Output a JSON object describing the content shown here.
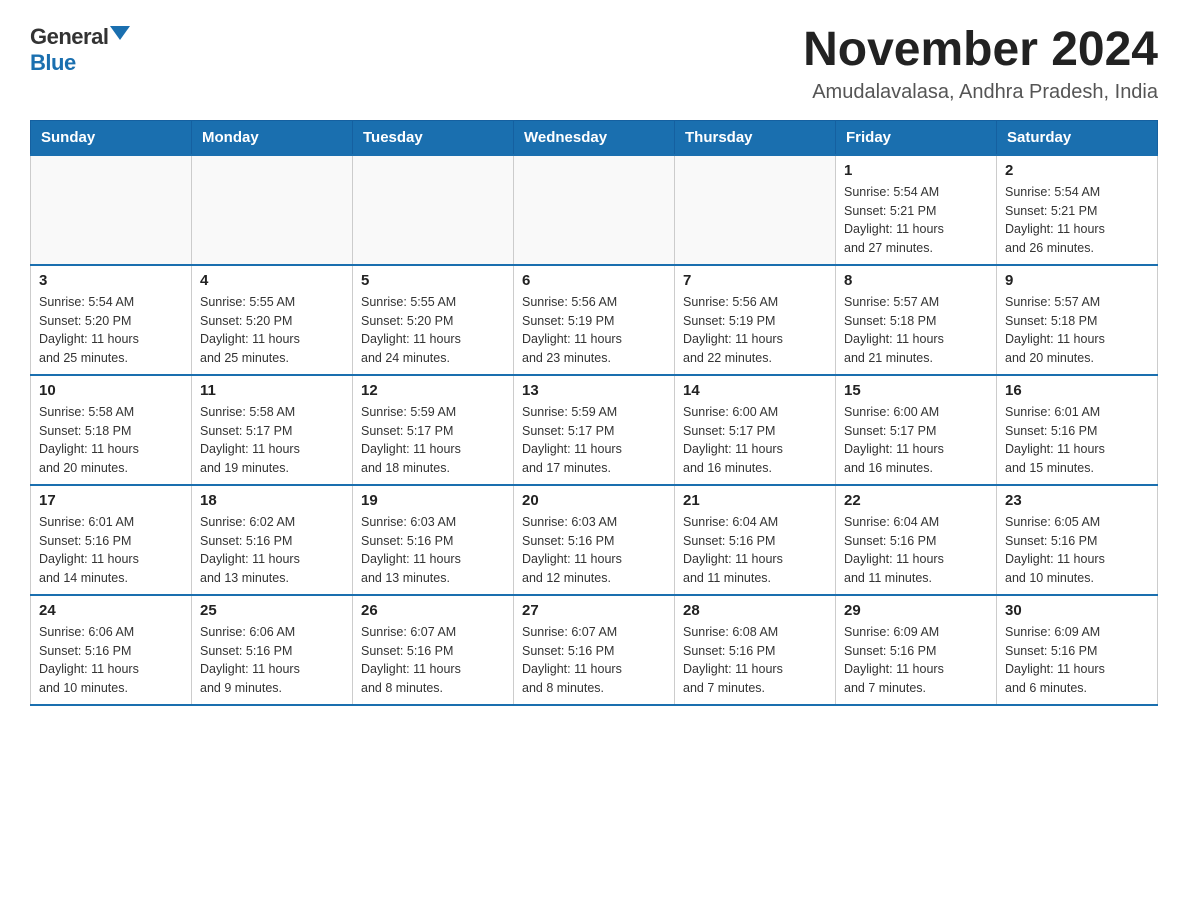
{
  "logo": {
    "general": "General",
    "blue": "Blue"
  },
  "title": "November 2024",
  "subtitle": "Amudalavalasa, Andhra Pradesh, India",
  "days_header": [
    "Sunday",
    "Monday",
    "Tuesday",
    "Wednesday",
    "Thursday",
    "Friday",
    "Saturday"
  ],
  "weeks": [
    [
      {
        "day": "",
        "info": ""
      },
      {
        "day": "",
        "info": ""
      },
      {
        "day": "",
        "info": ""
      },
      {
        "day": "",
        "info": ""
      },
      {
        "day": "",
        "info": ""
      },
      {
        "day": "1",
        "info": "Sunrise: 5:54 AM\nSunset: 5:21 PM\nDaylight: 11 hours\nand 27 minutes."
      },
      {
        "day": "2",
        "info": "Sunrise: 5:54 AM\nSunset: 5:21 PM\nDaylight: 11 hours\nand 26 minutes."
      }
    ],
    [
      {
        "day": "3",
        "info": "Sunrise: 5:54 AM\nSunset: 5:20 PM\nDaylight: 11 hours\nand 25 minutes."
      },
      {
        "day": "4",
        "info": "Sunrise: 5:55 AM\nSunset: 5:20 PM\nDaylight: 11 hours\nand 25 minutes."
      },
      {
        "day": "5",
        "info": "Sunrise: 5:55 AM\nSunset: 5:20 PM\nDaylight: 11 hours\nand 24 minutes."
      },
      {
        "day": "6",
        "info": "Sunrise: 5:56 AM\nSunset: 5:19 PM\nDaylight: 11 hours\nand 23 minutes."
      },
      {
        "day": "7",
        "info": "Sunrise: 5:56 AM\nSunset: 5:19 PM\nDaylight: 11 hours\nand 22 minutes."
      },
      {
        "day": "8",
        "info": "Sunrise: 5:57 AM\nSunset: 5:18 PM\nDaylight: 11 hours\nand 21 minutes."
      },
      {
        "day": "9",
        "info": "Sunrise: 5:57 AM\nSunset: 5:18 PM\nDaylight: 11 hours\nand 20 minutes."
      }
    ],
    [
      {
        "day": "10",
        "info": "Sunrise: 5:58 AM\nSunset: 5:18 PM\nDaylight: 11 hours\nand 20 minutes."
      },
      {
        "day": "11",
        "info": "Sunrise: 5:58 AM\nSunset: 5:17 PM\nDaylight: 11 hours\nand 19 minutes."
      },
      {
        "day": "12",
        "info": "Sunrise: 5:59 AM\nSunset: 5:17 PM\nDaylight: 11 hours\nand 18 minutes."
      },
      {
        "day": "13",
        "info": "Sunrise: 5:59 AM\nSunset: 5:17 PM\nDaylight: 11 hours\nand 17 minutes."
      },
      {
        "day": "14",
        "info": "Sunrise: 6:00 AM\nSunset: 5:17 PM\nDaylight: 11 hours\nand 16 minutes."
      },
      {
        "day": "15",
        "info": "Sunrise: 6:00 AM\nSunset: 5:17 PM\nDaylight: 11 hours\nand 16 minutes."
      },
      {
        "day": "16",
        "info": "Sunrise: 6:01 AM\nSunset: 5:16 PM\nDaylight: 11 hours\nand 15 minutes."
      }
    ],
    [
      {
        "day": "17",
        "info": "Sunrise: 6:01 AM\nSunset: 5:16 PM\nDaylight: 11 hours\nand 14 minutes."
      },
      {
        "day": "18",
        "info": "Sunrise: 6:02 AM\nSunset: 5:16 PM\nDaylight: 11 hours\nand 13 minutes."
      },
      {
        "day": "19",
        "info": "Sunrise: 6:03 AM\nSunset: 5:16 PM\nDaylight: 11 hours\nand 13 minutes."
      },
      {
        "day": "20",
        "info": "Sunrise: 6:03 AM\nSunset: 5:16 PM\nDaylight: 11 hours\nand 12 minutes."
      },
      {
        "day": "21",
        "info": "Sunrise: 6:04 AM\nSunset: 5:16 PM\nDaylight: 11 hours\nand 11 minutes."
      },
      {
        "day": "22",
        "info": "Sunrise: 6:04 AM\nSunset: 5:16 PM\nDaylight: 11 hours\nand 11 minutes."
      },
      {
        "day": "23",
        "info": "Sunrise: 6:05 AM\nSunset: 5:16 PM\nDaylight: 11 hours\nand 10 minutes."
      }
    ],
    [
      {
        "day": "24",
        "info": "Sunrise: 6:06 AM\nSunset: 5:16 PM\nDaylight: 11 hours\nand 10 minutes."
      },
      {
        "day": "25",
        "info": "Sunrise: 6:06 AM\nSunset: 5:16 PM\nDaylight: 11 hours\nand 9 minutes."
      },
      {
        "day": "26",
        "info": "Sunrise: 6:07 AM\nSunset: 5:16 PM\nDaylight: 11 hours\nand 8 minutes."
      },
      {
        "day": "27",
        "info": "Sunrise: 6:07 AM\nSunset: 5:16 PM\nDaylight: 11 hours\nand 8 minutes."
      },
      {
        "day": "28",
        "info": "Sunrise: 6:08 AM\nSunset: 5:16 PM\nDaylight: 11 hours\nand 7 minutes."
      },
      {
        "day": "29",
        "info": "Sunrise: 6:09 AM\nSunset: 5:16 PM\nDaylight: 11 hours\nand 7 minutes."
      },
      {
        "day": "30",
        "info": "Sunrise: 6:09 AM\nSunset: 5:16 PM\nDaylight: 11 hours\nand 6 minutes."
      }
    ]
  ]
}
